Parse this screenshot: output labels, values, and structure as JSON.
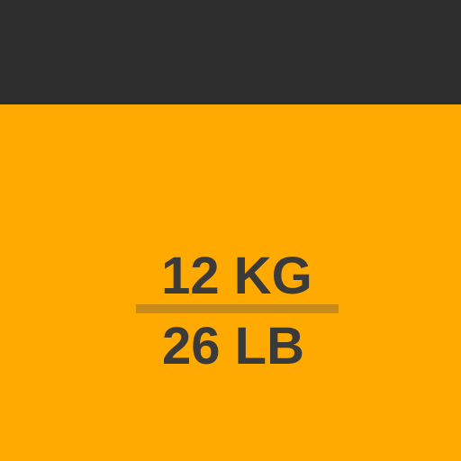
{
  "colors": {
    "top_bar": "#2d2d2d",
    "panel": "#ffaa00",
    "text": "#3a3a3a",
    "divider": "#c78b1c"
  },
  "weight": {
    "kg_label": "12 KG",
    "lb_label": "26 LB"
  }
}
